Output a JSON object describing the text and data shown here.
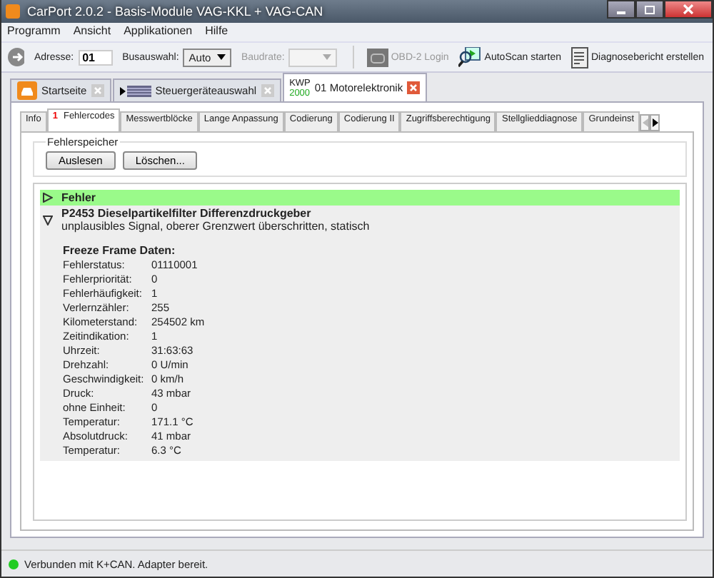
{
  "window": {
    "title": "CarPort 2.0.2  - Basis-Module VAG-KKL + VAG-CAN"
  },
  "menu": [
    "Programm",
    "Ansicht",
    "Applikationen",
    "Hilfe"
  ],
  "toolbar": {
    "address_label": "Adresse:",
    "address_value": "01",
    "bus_label": "Busauswahl:",
    "bus_value": "Auto",
    "baud_label": "Baudrate:",
    "actions": [
      {
        "kind": "obd",
        "label": "OBD-2 Login",
        "disabled": true
      },
      {
        "kind": "scan",
        "label": "AutoScan starten",
        "disabled": false
      },
      {
        "kind": "report",
        "label": "Diagnosebericht erstellen",
        "disabled": false
      }
    ]
  },
  "doc_tabs": [
    {
      "kind": "home",
      "label": "Startseite",
      "selected": false
    },
    {
      "kind": "ecu",
      "label": "Steuergeräteauswahl",
      "selected": false
    },
    {
      "kind": "module",
      "protocol": "KWP",
      "protocol_version": "2000",
      "label": "01 Motorelektronik",
      "selected": true
    }
  ],
  "inner_tabs": [
    {
      "label": "Info",
      "selected": false
    },
    {
      "badge": "1",
      "label": "Fehlercodes",
      "selected": true
    },
    {
      "label": "Messwertblöcke",
      "selected": false
    },
    {
      "label": "Lange Anpassung",
      "selected": false
    },
    {
      "label": "Codierung",
      "selected": false
    },
    {
      "label": "Codierung II",
      "selected": false
    },
    {
      "label": "Zugriffsberechtigung",
      "selected": false
    },
    {
      "label": "Stellglieddiagnose",
      "selected": false
    },
    {
      "label": "Grundeinst",
      "selected": false
    }
  ],
  "fehlerspeicher": {
    "title": "Fehlerspeicher",
    "buttons": [
      "Auslesen",
      "Löschen..."
    ]
  },
  "results": {
    "header": "Fehler",
    "fault": {
      "title": "P2453 Dieselpartikelfilter Differenzdruckgeber",
      "description": "unplausibles Signal, oberer Grenzwert überschritten, statisch",
      "expanded": true
    },
    "freeze_title": "Freeze Frame Daten:",
    "rows": [
      {
        "label": "Fehlerstatus:",
        "value": "01110001"
      },
      {
        "label": "Fehlerpriorität:",
        "value": "0"
      },
      {
        "label": "Fehlerhäufigkeit:",
        "value": "1"
      },
      {
        "label": "Verlernzähler:",
        "value": "255"
      },
      {
        "label": "Kilometerstand:",
        "value": "254502 km"
      },
      {
        "label": "Zeitindikation:",
        "value": "1"
      },
      {
        "label": "Uhrzeit:",
        "value": "31:63:63"
      },
      {
        "label": "Drehzahl:",
        "value": "0 U/min"
      },
      {
        "label": "Geschwindigkeit:",
        "value": "0 km/h"
      },
      {
        "label": "Druck:",
        "value": "43 mbar"
      },
      {
        "label": "ohne Einheit:",
        "value": "0"
      },
      {
        "label": "Temperatur:",
        "value": "171.1 °C"
      },
      {
        "label": "Absolutdruck:",
        "value": "41 mbar"
      },
      {
        "label": "Temperatur:",
        "value": "6.3 °C"
      }
    ]
  },
  "status_bar": {
    "text": "Verbunden mit K+CAN. Adapter bereit.",
    "connected": true
  }
}
